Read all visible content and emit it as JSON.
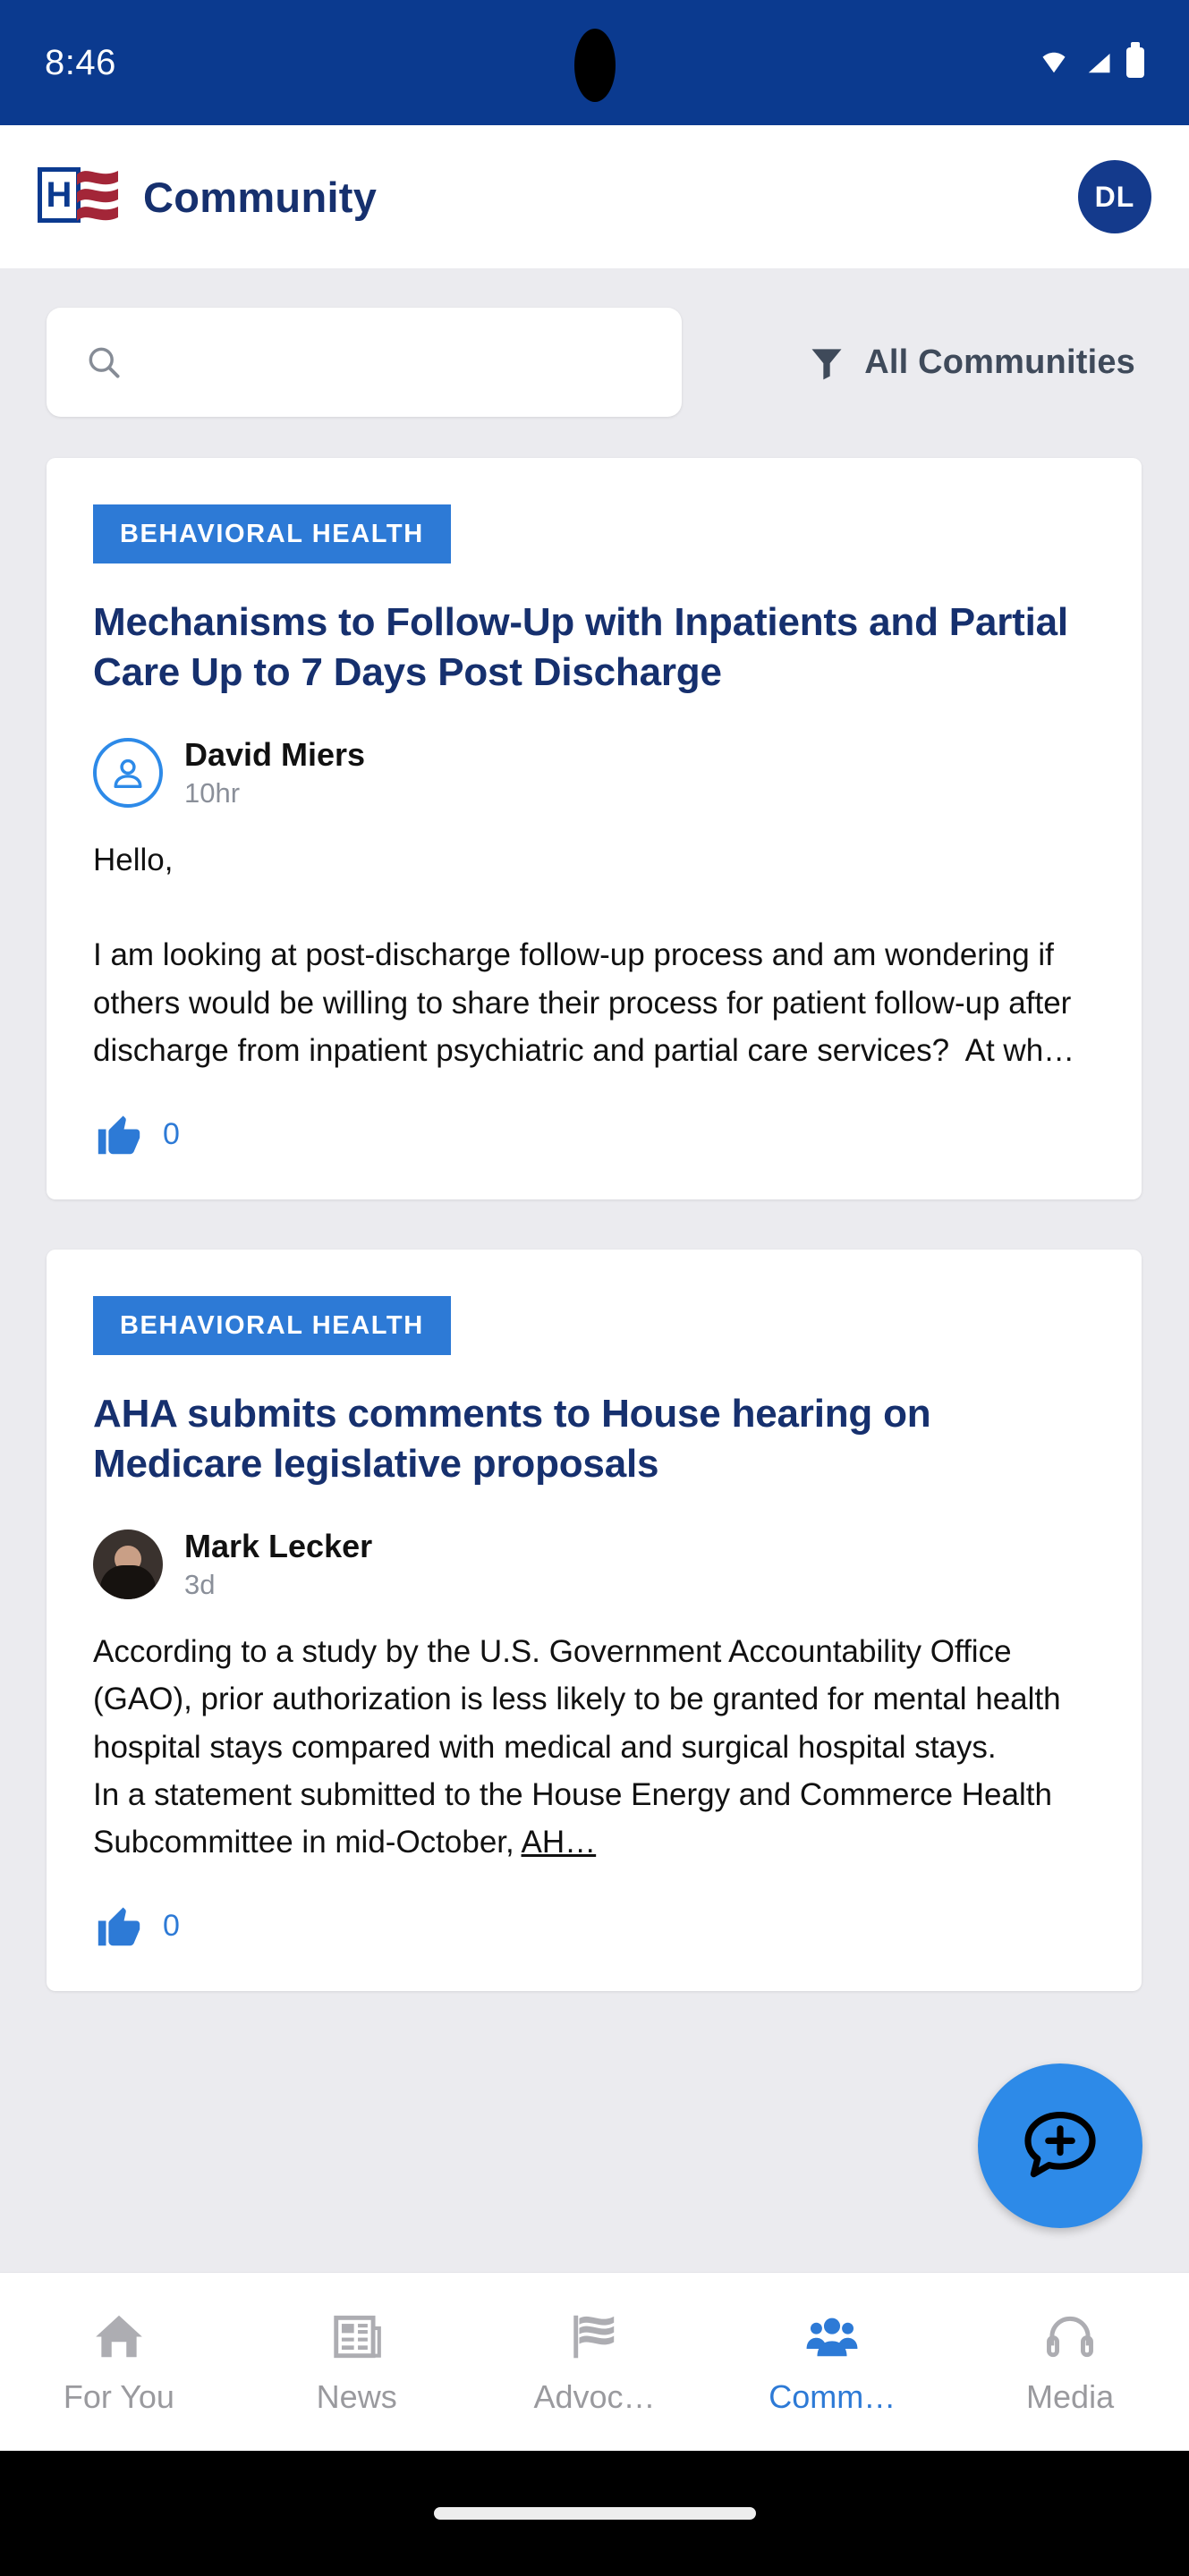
{
  "status_bar": {
    "time": "8:46",
    "icons": [
      "wifi-icon",
      "cellular-signal-icon",
      "battery-icon"
    ],
    "background": "#0b3a8f"
  },
  "header": {
    "logo_letter": "H",
    "logo_name": "aha-flag-logo",
    "title": "Community",
    "title_color": "#16306e",
    "avatar_initials": "DL",
    "avatar_color": "#143a8c"
  },
  "search": {
    "placeholder": "",
    "value": "",
    "icon": "search-icon"
  },
  "filter": {
    "icon": "funnel-filter-icon",
    "label": "All Communities"
  },
  "feed": {
    "posts": [
      {
        "category": "BEHAVIORAL HEALTH",
        "category_color": "#2d7ad6",
        "title": "Mechanisms to Follow-Up with Inpatients and Partial Care Up to 7 Days Post Discharge",
        "author": "David Miers",
        "author_avatar_type": "person-outline-icon",
        "time": "10hr",
        "body": "Hello,\n\nI am looking at post-discharge follow-up process and am wondering if others would be willing to share their process for patient follow-up after discharge from inpatient psychiatric and partial care services?  At wh…",
        "like_icon": "thumbs-up-icon",
        "like_count": "0"
      },
      {
        "category": "BEHAVIORAL HEALTH",
        "category_color": "#2d7ad6",
        "title": "AHA submits comments to House hearing on Medicare legislative proposals",
        "author": "Mark Lecker",
        "author_avatar_type": "profile-photo",
        "time": "3d",
        "body": "According to a study by the U.S. Government Accountability Office (GAO), prior authorization is less likely to be granted for mental health hospital stays compared with medical and surgical hospital stays.\nIn a statement submitted to the House Energy and Commerce Health Subcommittee in mid-October, ",
        "body_link": "AH…",
        "like_icon": "thumbs-up-icon",
        "like_count": "0"
      }
    ]
  },
  "fab": {
    "icon": "new-message-icon",
    "color": "#2d8ae8"
  },
  "bottom_nav": {
    "active_color": "#2d7ad6",
    "inactive_color": "#9a9a9e",
    "items": [
      {
        "label": "For You",
        "icon": "home-icon",
        "active": false
      },
      {
        "label": "News",
        "icon": "newspaper-icon",
        "active": false
      },
      {
        "label": "Advoc…",
        "icon": "flag-icon",
        "active": false
      },
      {
        "label": "Comm…",
        "icon": "people-group-icon",
        "active": true
      },
      {
        "label": "Media",
        "icon": "headphones-icon",
        "active": false
      }
    ]
  }
}
